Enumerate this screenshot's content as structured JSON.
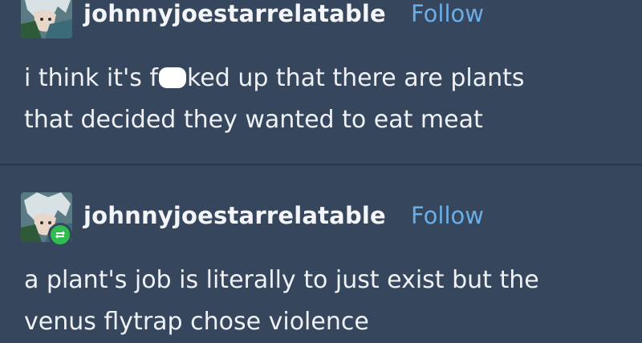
{
  "posts": [
    {
      "username": "johnnyjoestarrelatable",
      "follow_label": "Follow",
      "avatar_icon": "jojo-character-avatar",
      "line1_before": "i think it's f",
      "line1_censor_icon": "white-censor-blob",
      "line1_after": "ked up that there are plants",
      "line2": "that decided they wanted to eat meat"
    },
    {
      "username": "johnnyjoestarrelatable",
      "follow_label": "Follow",
      "avatar_icon": "jojo-character-avatar",
      "badge_icon": "reblog-icon",
      "line1": "a plant's job is literally to just exist but the",
      "line2": "venus flytrap chose violence"
    }
  ],
  "colors": {
    "background": "#36465d",
    "follow": "#6aaee8",
    "reblog_badge": "#2fbd4f"
  }
}
